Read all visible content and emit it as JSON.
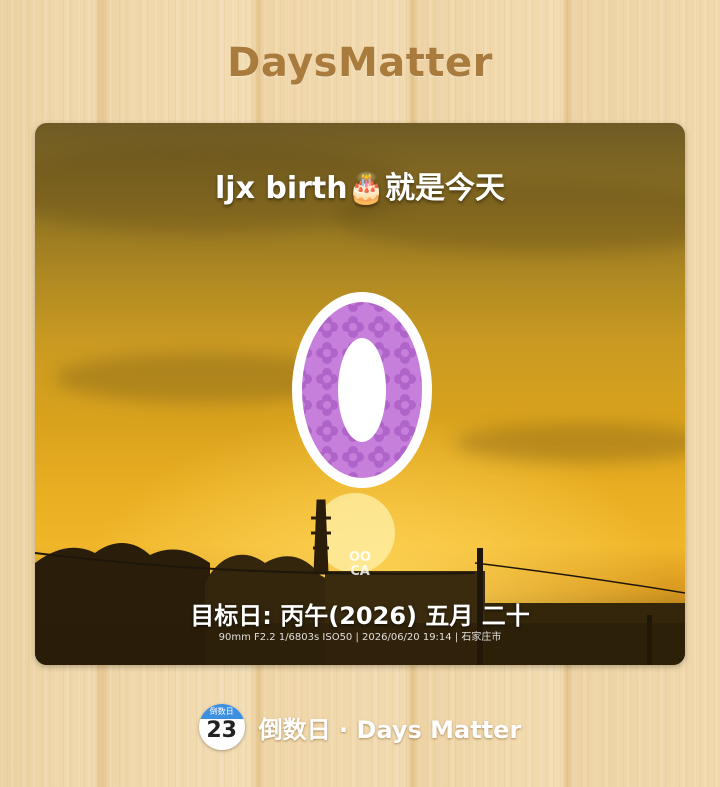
{
  "app": {
    "title": "DaysMatter"
  },
  "event_card": {
    "title": "ljx birth🎂就是今天",
    "days_count": "0",
    "target_date": "目标日: 丙午(2026) 五月 二十",
    "photo_exif": "90mm  F2.2  1/6803s  ISO50  |  2026/06/20 19:14  |  石家庄市",
    "photo_logo": "OO\nCA",
    "count_color": "#c77fdc",
    "count_outline_color": "#ffffff"
  },
  "footer": {
    "icon_label": "倒数日",
    "icon_day": "23",
    "text": "倒数日 · Days Matter",
    "icon_accent": "#3d8fe0"
  }
}
